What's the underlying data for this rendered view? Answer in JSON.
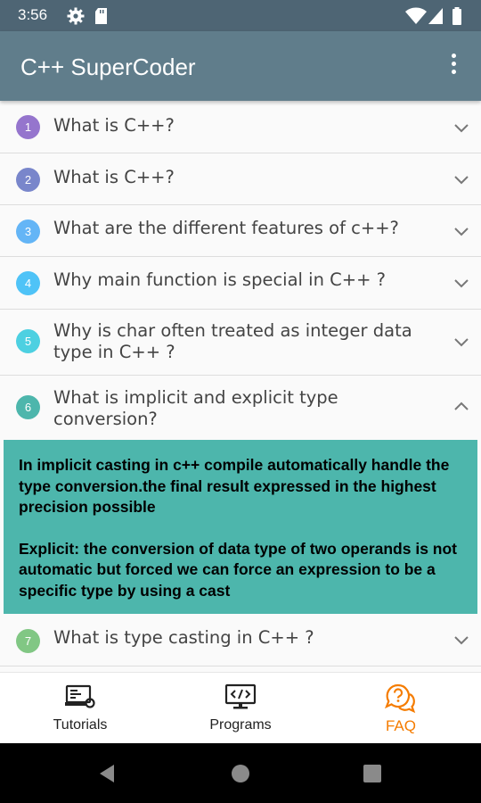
{
  "status_bar": {
    "time": "3:56"
  },
  "app_bar": {
    "title": "C++ SuperCoder"
  },
  "faq": [
    {
      "num": "1",
      "question": "What is C++?",
      "color": "#9575cd",
      "expanded": false
    },
    {
      "num": "2",
      "question": "What is C++?",
      "color": "#7986cb",
      "expanded": false
    },
    {
      "num": "3",
      "question": "What are the different features of c++?",
      "color": "#64b5f6",
      "expanded": false
    },
    {
      "num": "4",
      "question": "Why main function is special in C++ ?",
      "color": "#4fc3f7",
      "expanded": false
    },
    {
      "num": "5",
      "question": "Why is char often treated as integer data type in C++ ?",
      "color": "#4dd0e1",
      "expanded": false
    },
    {
      "num": "6",
      "question": "What is implicit and explicit type conversion?",
      "color": "#4db6ac",
      "expanded": true,
      "answer": [
        "In implicit casting in c++ compile automatically handle the type conversion.the final result expressed in the highest precision possible",
        "Explicit: the conversion of data type of two operands is not automatic but forced we can force an expression to be a specific type by using a cast"
      ]
    },
    {
      "num": "7",
      "question": "What is type casting in C++ ?",
      "color": "#81c784",
      "expanded": false
    }
  ],
  "bottom_nav": {
    "tutorials": "Tutorials",
    "programs": "Programs",
    "faq": "FAQ",
    "active": "faq",
    "active_color": "#f57c00"
  }
}
